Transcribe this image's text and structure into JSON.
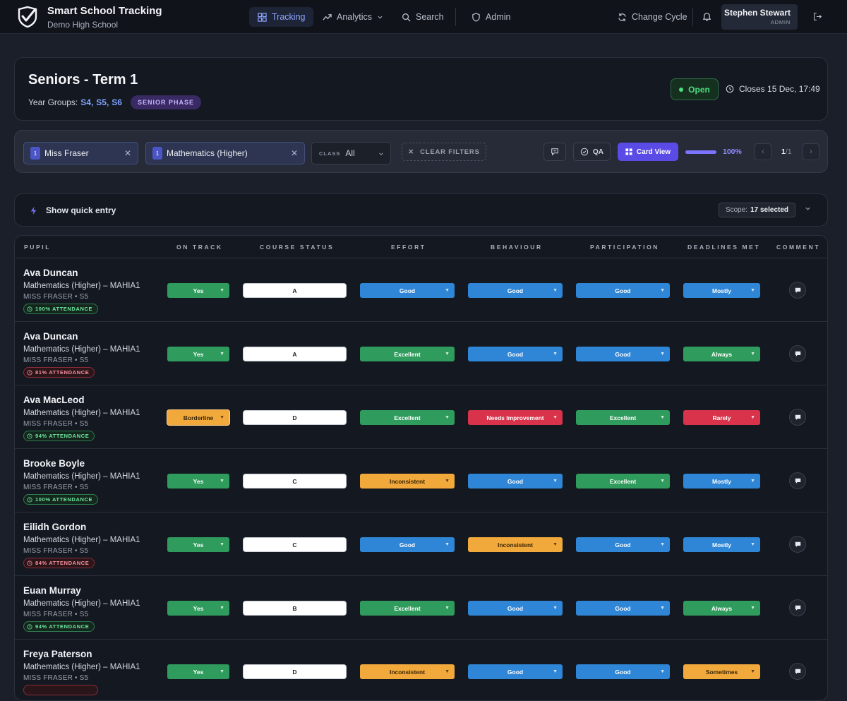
{
  "app": {
    "title": "Smart School Tracking",
    "subtitle": "Demo High School"
  },
  "nav": {
    "tracking": "Tracking",
    "analytics": "Analytics",
    "search": "Search",
    "admin": "Admin",
    "change_cycle": "Change Cycle"
  },
  "user": {
    "name": "Stephen Stewart",
    "role": "ADMIN"
  },
  "cycle": {
    "title": "Seniors - Term 1",
    "year_groups_label": "Year Groups:",
    "year_groups": [
      "S4,",
      "S5,",
      "S6"
    ],
    "phase": "SENIOR PHASE",
    "status": "Open",
    "closes": "Closes 15 Dec, 17:49"
  },
  "filters": {
    "teacher_count": "1",
    "teacher": "Miss Fraser",
    "course_count": "1",
    "course": "Mathematics (Higher)",
    "class_label": "CLASS",
    "class_value": "All",
    "clear": "CLEAR FILTERS",
    "qa": "QA",
    "card_view": "Card View",
    "progress_value": 1.0,
    "progress_text": "100%",
    "page_current": "1",
    "page_total": "/1"
  },
  "quick_entry": {
    "label": "Show quick entry",
    "scope_label": "Scope:",
    "scope_value": "17 selected"
  },
  "table": {
    "columns": [
      "PUPIL",
      "ON TRACK",
      "COURSE STATUS",
      "EFFORT",
      "BEHAVIOUR",
      "PARTICIPATION",
      "DEADLINES MET",
      "COMMENT"
    ],
    "rows": [
      {
        "name": "Ava Duncan",
        "course": "Mathematics (Higher) – MAHIA1",
        "teacher": "MISS FRASER • S5",
        "attendance": "100% ATTENDANCE",
        "att_level": "good",
        "on_track": "Yes",
        "status": "A",
        "effort": "Good",
        "behaviour": "Good",
        "participation": "Good",
        "deadlines": "Mostly"
      },
      {
        "name": "Ava Duncan",
        "course": "Mathematics (Higher) – MAHIA1",
        "teacher": "MISS FRASER • S5",
        "attendance": "81% ATTENDANCE",
        "att_level": "warn",
        "on_track": "Yes",
        "status": "A",
        "effort": "Excellent",
        "behaviour": "Good",
        "participation": "Good",
        "deadlines": "Always"
      },
      {
        "name": "Ava MacLeod",
        "course": "Mathematics (Higher) – MAHIA1",
        "teacher": "MISS FRASER • S5",
        "attendance": "94% ATTENDANCE",
        "att_level": "good",
        "on_track": "Borderline",
        "status": "D",
        "effort": "Excellent",
        "behaviour": "Needs Improvement",
        "participation": "Excellent",
        "deadlines": "Rarely"
      },
      {
        "name": "Brooke Boyle",
        "course": "Mathematics (Higher) – MAHIA1",
        "teacher": "MISS FRASER • S5",
        "attendance": "100% ATTENDANCE",
        "att_level": "good",
        "on_track": "Yes",
        "status": "C",
        "effort": "Inconsistent",
        "behaviour": "Good",
        "participation": "Excellent",
        "deadlines": "Mostly"
      },
      {
        "name": "Eilidh Gordon",
        "course": "Mathematics (Higher) – MAHIA1",
        "teacher": "MISS FRASER • S5",
        "attendance": "84% ATTENDANCE",
        "att_level": "warn",
        "on_track": "Yes",
        "status": "C",
        "effort": "Good",
        "behaviour": "Inconsistent",
        "participation": "Good",
        "deadlines": "Mostly"
      },
      {
        "name": "Euan Murray",
        "course": "Mathematics (Higher) – MAHIA1",
        "teacher": "MISS FRASER • S5",
        "attendance": "94% ATTENDANCE",
        "att_level": "good",
        "on_track": "Yes",
        "status": "B",
        "effort": "Excellent",
        "behaviour": "Good",
        "participation": "Good",
        "deadlines": "Always"
      },
      {
        "name": "Freya Paterson",
        "course": "Mathematics (Higher) – MAHIA1",
        "teacher": "MISS FRASER • S5",
        "attendance": "",
        "att_level": "warn",
        "on_track": "Yes",
        "status": "D",
        "effort": "Inconsistent",
        "behaviour": "Good",
        "participation": "Good",
        "deadlines": "Sometimes"
      }
    ]
  },
  "colors": {
    "accent": "#5b4be6",
    "good": "#2f9b5c",
    "neutral": "#2f86d6",
    "caution": "#f2a93b",
    "bad": "#d8334a"
  }
}
